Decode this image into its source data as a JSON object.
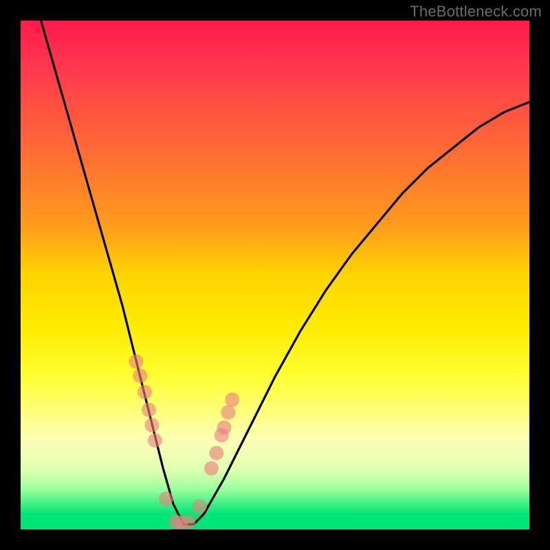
{
  "watermark": "TheBottleneck.com",
  "chart_data": {
    "type": "line",
    "title": "",
    "xlabel": "",
    "ylabel": "",
    "xlim": [
      0,
      100
    ],
    "ylim": [
      0,
      100
    ],
    "grid": false,
    "series": [
      {
        "name": "bottleneck-curve",
        "x": [
          4,
          8,
          12,
          16,
          20,
          23,
          26,
          28,
          30,
          32,
          34,
          36,
          40,
          45,
          50,
          55,
          60,
          65,
          70,
          75,
          80,
          85,
          90,
          95,
          100
        ],
        "y": [
          100,
          86,
          72,
          58,
          44,
          32,
          20,
          12,
          5,
          1,
          1,
          3,
          10,
          20,
          30,
          39,
          47,
          54,
          60,
          66,
          71,
          75,
          79,
          82,
          84
        ]
      }
    ],
    "markers": {
      "name": "highlight-points",
      "x": [
        22.7,
        23.5,
        24.4,
        25.2,
        25.8,
        26.4,
        28.6,
        30.5,
        31.5,
        33.0,
        35.2,
        37.5,
        38.5,
        39.5,
        40.0,
        40.8,
        41.6
      ],
      "y": [
        33.0,
        30.2,
        27.0,
        23.5,
        20.5,
        17.5,
        6.0,
        1.5,
        1.3,
        1.5,
        4.5,
        12.0,
        15.0,
        18.5,
        20.0,
        23.0,
        25.5
      ]
    }
  }
}
